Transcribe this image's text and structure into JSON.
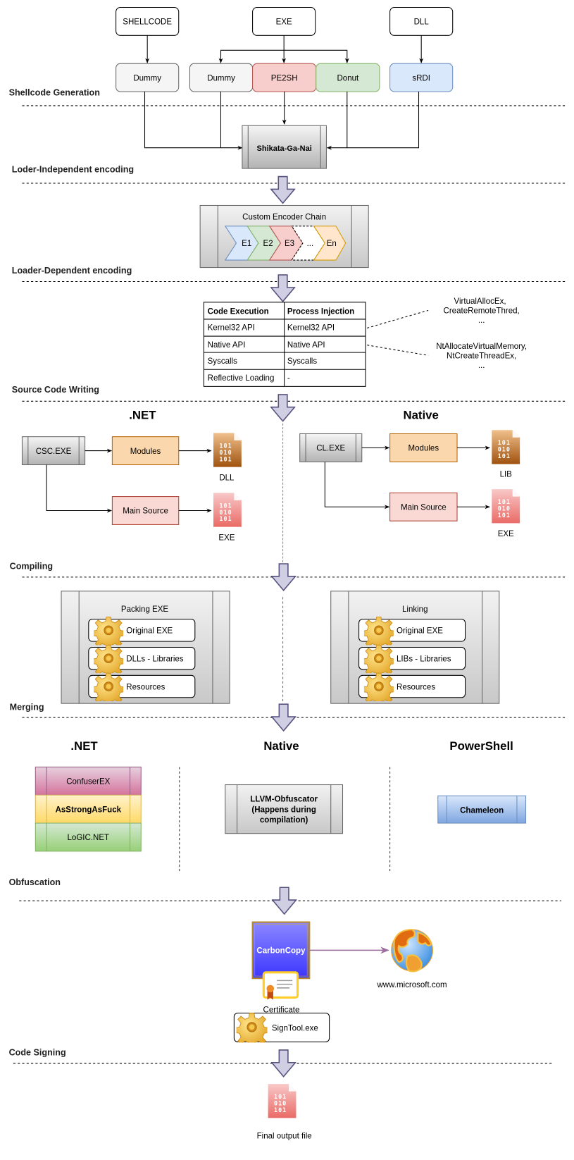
{
  "sections": {
    "shellcode_generation": "Shellcode Generation",
    "loader_independent": "Loder-Independent encoding",
    "loader_dependent": "Loader-Dependent encoding",
    "source_code_writing": "Source Code Writing",
    "compiling": "Compiling",
    "merging": "Merging",
    "obfuscation": "Obfuscation",
    "code_signing": "Code Signing"
  },
  "inputs": [
    "SHELLCODE",
    "EXE",
    "DLL"
  ],
  "generators": {
    "dummy1": "Dummy",
    "dummy2": "Dummy",
    "pe2sh": "PE2SH",
    "donut": "Donut",
    "srdi": "sRDI"
  },
  "shikata": "Shikata-Ga-Nai",
  "encoder_chain": {
    "title": "Custom Encoder Chain",
    "steps": [
      "E1",
      "E2",
      "E3",
      "...",
      "En"
    ]
  },
  "technique_table": {
    "headers": [
      "Code Execution",
      "Process Injection"
    ],
    "rows": [
      [
        "Kernel32 API",
        "Kernel32 API"
      ],
      [
        "Native API",
        "Native API"
      ],
      [
        "Syscalls",
        "Syscalls"
      ],
      [
        "Reflective Loading",
        "-"
      ]
    ]
  },
  "annotations": {
    "kernel32": [
      "VirtualAllocEx,",
      "CreateRemoteThred,",
      "..."
    ],
    "native": [
      "NtAllocateVirtualMemory,",
      "NtCreateThreadEx,",
      "..."
    ]
  },
  "source_writing": {
    "dotnet": {
      "title": ".NET",
      "compiler": "CSC.EXE",
      "modules": "Modules",
      "main_source": "Main Source",
      "module_output": "DLL",
      "main_output": "EXE"
    },
    "native": {
      "title": "Native",
      "compiler": "CL.EXE",
      "modules": "Modules",
      "main_source": "Main Source",
      "module_output": "LIB",
      "main_output": "EXE"
    },
    "binary_glyph": [
      "101",
      "010",
      "101"
    ]
  },
  "compiling": {
    "packing": {
      "title": "Packing EXE",
      "items": [
        "Original EXE",
        "DLLs - Libraries",
        "Resources"
      ]
    },
    "linking": {
      "title": "Linking",
      "items": [
        "Original EXE",
        "LIBs - Libraries",
        "Resources"
      ]
    }
  },
  "obfuscation": {
    "dotnet": {
      "title": ".NET",
      "tools": [
        "ConfuserEX",
        "AsStrongAsFuck",
        "LoGIC.NET"
      ]
    },
    "native": {
      "title": "Native",
      "tool_lines": [
        "LLVM-Obfuscator",
        "(Happens during",
        "compilation)"
      ]
    },
    "powershell": {
      "title": "PowerShell",
      "tool": "Chameleon"
    }
  },
  "signing": {
    "carboncopy": "CarbonCopy",
    "certificate": "Certificate",
    "domain": "www.microsoft.com",
    "signtool": "SignTool.exe"
  },
  "final_output": "Final output file",
  "colors": {
    "gray_fill": "#f5f5f5",
    "red_fill": "#f8cecc",
    "red_stroke": "#b85450",
    "green_fill": "#d5e8d4",
    "green_stroke": "#82b366",
    "blue_fill": "#dae8fc",
    "blue_stroke": "#6c8ebf",
    "orange_fill": "#ffe6cc",
    "orange_stroke": "#d79b00",
    "module_fill": "#fad7ac",
    "module_stroke": "#b46504",
    "arrow_fill": "#d0cee2",
    "arrow_stroke": "#56517e",
    "carbon_fill": "#4a44ff",
    "link_arrow": "#9c6d9c"
  }
}
